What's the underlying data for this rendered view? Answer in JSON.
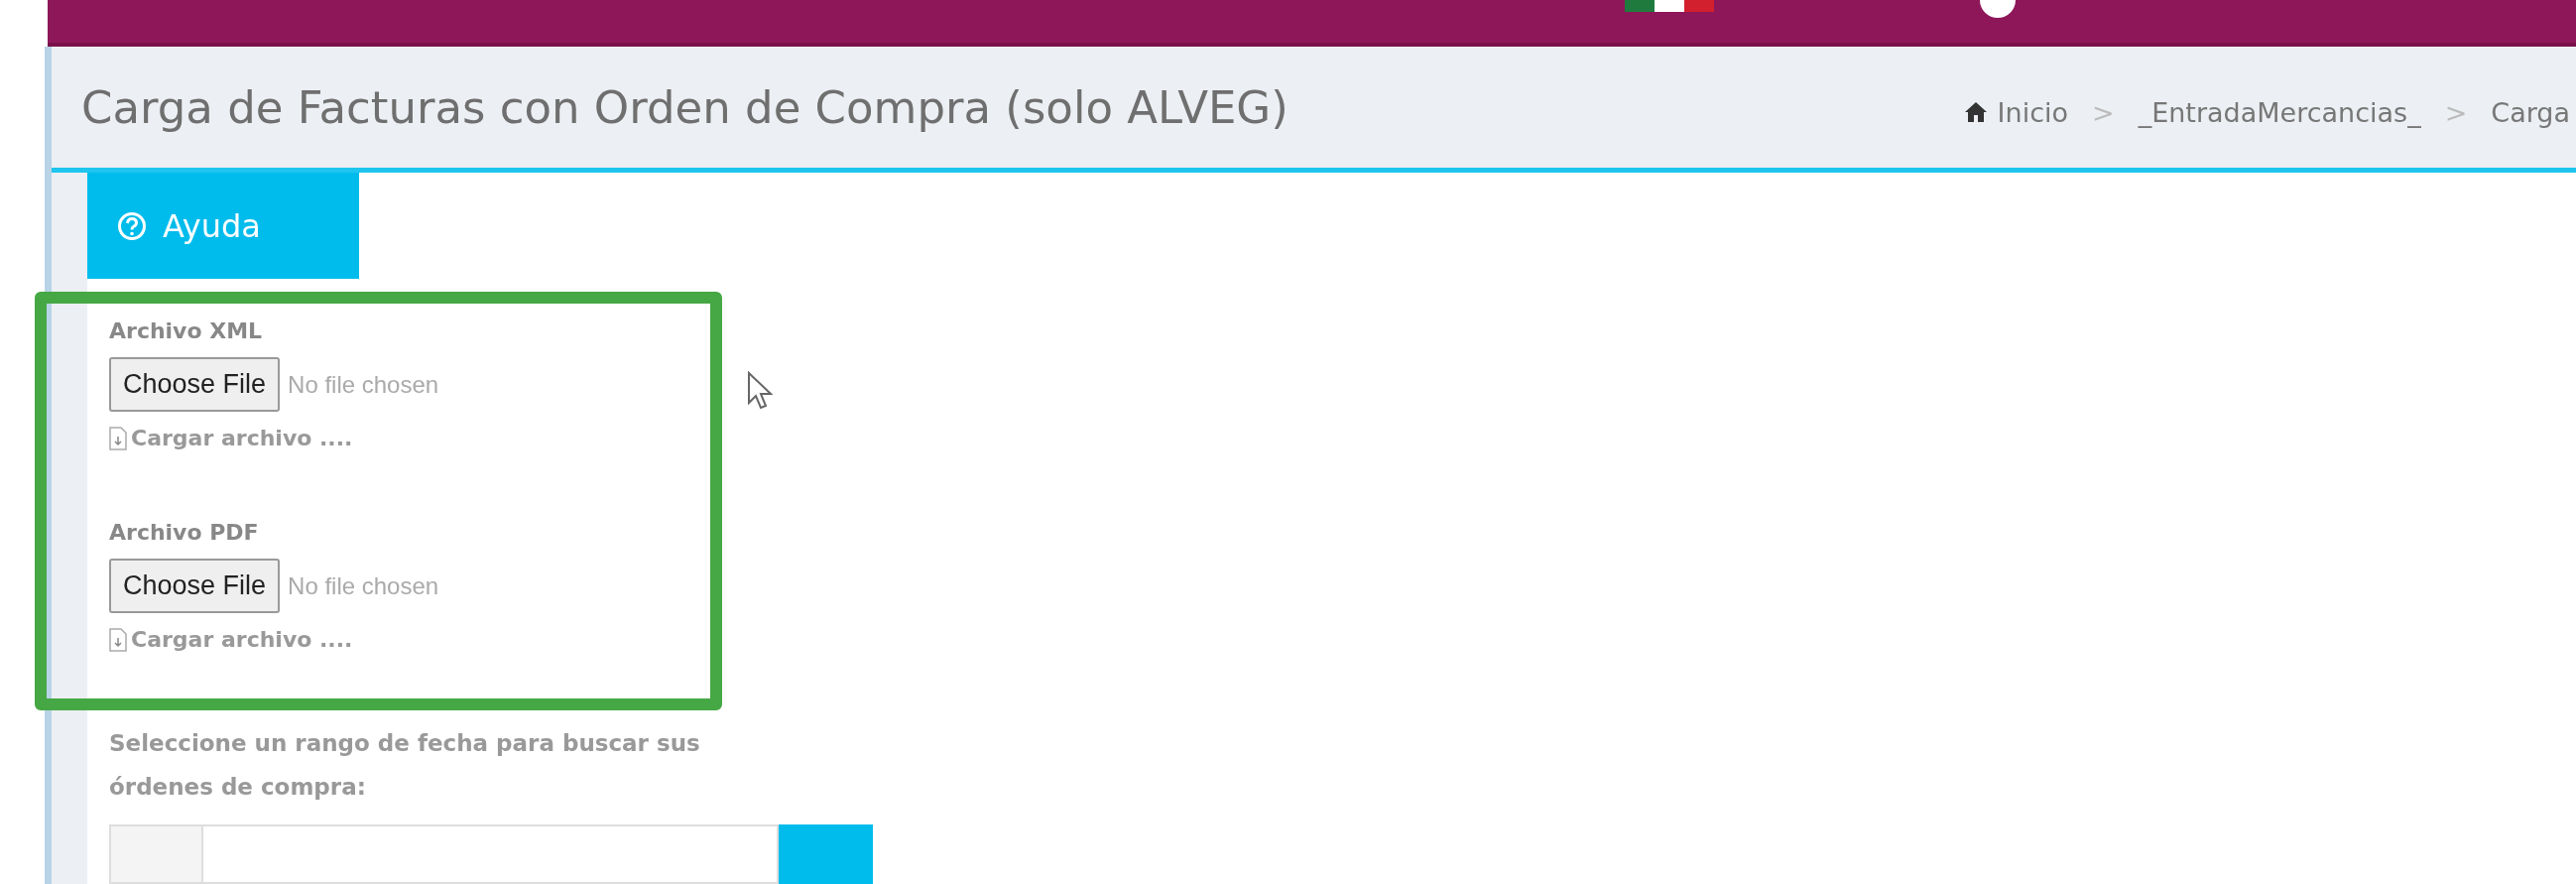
{
  "page_title": "Carga de Facturas con Orden de Compra (solo ALVEG)",
  "breadcrumb": [
    {
      "kind": "home",
      "label": "Inicio"
    },
    {
      "kind": "sep",
      "label": ">"
    },
    {
      "kind": "link",
      "label": "_EntradaMercancias_"
    },
    {
      "kind": "sep",
      "label": ">"
    },
    {
      "kind": "link",
      "label": "Carga"
    }
  ],
  "help_tab": {
    "label": "Ayuda"
  },
  "uploads": [
    {
      "label": "Archivo XML",
      "button": "Choose File",
      "status": "No file chosen",
      "hint": "Cargar archivo ...."
    },
    {
      "label": "Archivo PDF",
      "button": "Choose File",
      "status": "No file chosen",
      "hint": "Cargar archivo ...."
    }
  ],
  "date_prompt": "Seleccione un rango de fecha para buscar sus órdenes de compra:"
}
